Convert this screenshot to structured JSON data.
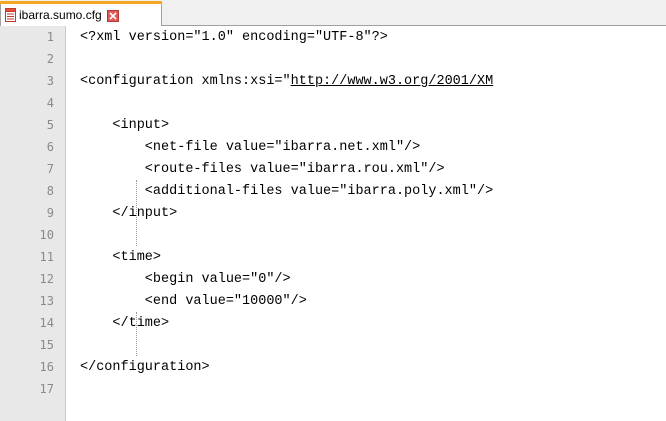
{
  "tab": {
    "label": "ibarra.sumo.cfg"
  },
  "editor": {
    "lines": [
      {
        "num": "1",
        "pre": "<?xml version=\"1.0\" encoding=\"UTF-8\"?>",
        "url": "",
        "post": ""
      },
      {
        "num": "2",
        "pre": "",
        "url": "",
        "post": ""
      },
      {
        "num": "3",
        "pre": "<configuration xmlns:xsi=\"",
        "url": "http://www.w3.org/2001/XM",
        "post": ""
      },
      {
        "num": "4",
        "pre": "",
        "url": "",
        "post": ""
      },
      {
        "num": "5",
        "pre": "    <input>",
        "url": "",
        "post": ""
      },
      {
        "num": "6",
        "pre": "        <net-file value=\"ibarra.net.xml\"/>",
        "url": "",
        "post": ""
      },
      {
        "num": "7",
        "pre": "        <route-files value=\"ibarra.rou.xml\"/>",
        "url": "",
        "post": ""
      },
      {
        "num": "8",
        "pre": "        <additional-files value=\"ibarra.poly.xml\"/>",
        "url": "",
        "post": ""
      },
      {
        "num": "9",
        "pre": "    </input>",
        "url": "",
        "post": ""
      },
      {
        "num": "10",
        "pre": "",
        "url": "",
        "post": ""
      },
      {
        "num": "11",
        "pre": "    <time>",
        "url": "",
        "post": ""
      },
      {
        "num": "12",
        "pre": "        <begin value=\"0\"/>",
        "url": "",
        "post": ""
      },
      {
        "num": "13",
        "pre": "        <end value=\"10000\"/>",
        "url": "",
        "post": ""
      },
      {
        "num": "14",
        "pre": "    </time>",
        "url": "",
        "post": ""
      },
      {
        "num": "15",
        "pre": "",
        "url": "",
        "post": ""
      },
      {
        "num": "16",
        "pre": "</configuration>",
        "url": "",
        "post": ""
      },
      {
        "num": "17",
        "pre": "",
        "url": "",
        "post": ""
      }
    ]
  },
  "colors": {
    "tab_accent": "#f6a623",
    "close_icon": "#d9534f",
    "gutter_bg": "#e8e8e8",
    "line_number": "#8a8a8a"
  },
  "icons": {
    "file": "file-icon",
    "close": "close-icon"
  }
}
